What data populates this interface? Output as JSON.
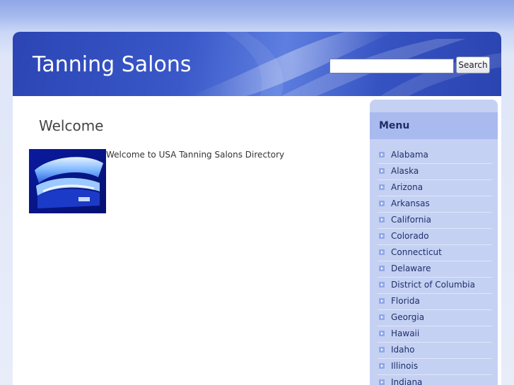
{
  "header": {
    "site_title": "Tanning Salons",
    "search_placeholder": "",
    "search_button_label": "Search"
  },
  "main": {
    "heading": "Welcome",
    "intro_text": "Welcome to USA Tanning Salons Directory",
    "image_icon": "tanning-bed-image"
  },
  "sidebar": {
    "title": "Menu",
    "items": [
      {
        "label": "Alabama"
      },
      {
        "label": "Alaska"
      },
      {
        "label": "Arizona"
      },
      {
        "label": "Arkansas"
      },
      {
        "label": "California"
      },
      {
        "label": "Colorado"
      },
      {
        "label": "Connecticut"
      },
      {
        "label": "Delaware"
      },
      {
        "label": "District of Columbia"
      },
      {
        "label": "Florida"
      },
      {
        "label": "Georgia"
      },
      {
        "label": "Hawaii"
      },
      {
        "label": "Idaho"
      },
      {
        "label": "Illinois"
      },
      {
        "label": "Indiana"
      }
    ]
  },
  "colors": {
    "header_blue": "#3552c2",
    "sidebar_bg": "#c5d1f3",
    "sidebar_header_bg": "#a9baef",
    "menu_text": "#1e2f68"
  }
}
